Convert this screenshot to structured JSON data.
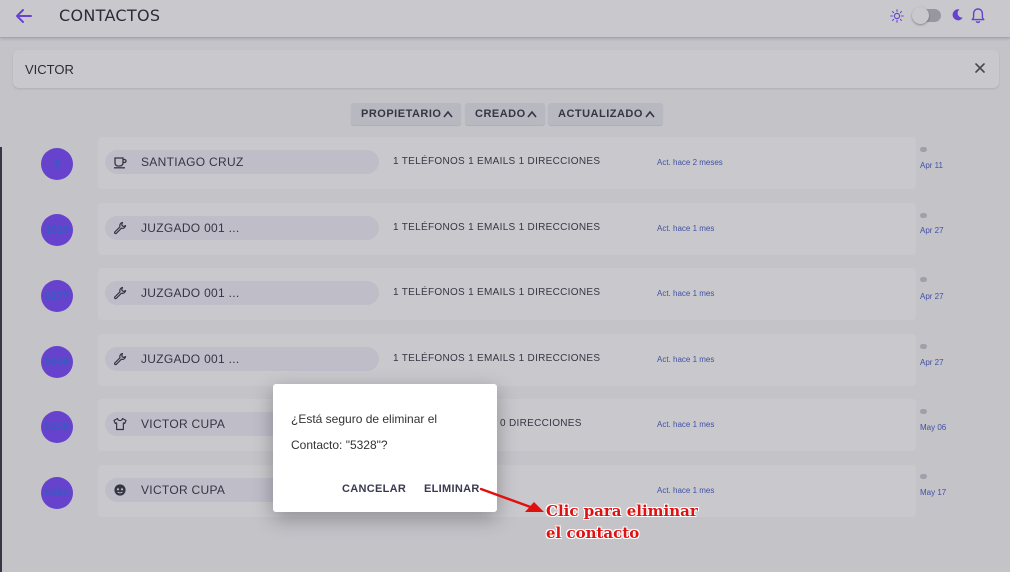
{
  "header": {
    "title": "CONTACTOS",
    "icons": {
      "back": "arrow-left-icon",
      "theme_light": "sun-icon",
      "theme_dark": "moon-icon",
      "notifications": "bell-icon"
    }
  },
  "search": {
    "value": "VICTOR",
    "clear_icon": "close-icon"
  },
  "sort": [
    {
      "label": "PROPIETARIO",
      "icon": "chevron-up-icon"
    },
    {
      "label": "CREADO",
      "icon": "chevron-up-icon"
    },
    {
      "label": "ACTUALIZADO",
      "icon": "chevron-up-icon"
    }
  ],
  "contacts": [
    {
      "id": "3",
      "name": "SANTIAGO CRUZ",
      "icon": "cup-icon",
      "summary": "1 TELÉFONOS 1 EMAILS 1 DIRECCIONES",
      "updated": "Act. hace 2 meses",
      "date": "Apr 11"
    },
    {
      "id": "1919",
      "name": "JUZGADO 001 ...",
      "icon": "wrench-icon",
      "summary": "1 TELÉFONOS 1 EMAILS 1 DIRECCIONES",
      "updated": "Act. hace 1 mes",
      "date": "Apr 27"
    },
    {
      "id": "2177",
      "name": "JUZGADO 001 ...",
      "icon": "wrench-icon",
      "summary": "1 TELÉFONOS 1 EMAILS 1 DIRECCIONES",
      "updated": "Act. hace 1 mes",
      "date": "Apr 27"
    },
    {
      "id": "5046",
      "name": "JUZGADO 001 ...",
      "icon": "wrench-icon",
      "summary": "1 TELÉFONOS 1 EMAILS 1 DIRECCIONES",
      "updated": "Act. hace 1 mes",
      "date": "Apr 27"
    },
    {
      "id": "5328",
      "name": "VICTOR CUPA",
      "icon": "shirt-icon",
      "summary": "S 0 DIRECCIONES",
      "updated": "Act. hace 1 mes",
      "date": "May 06"
    },
    {
      "id": "5354",
      "name": "VICTOR CUPA",
      "icon": "face-icon",
      "summary": "",
      "updated": "Act. hace 1 mes",
      "date": "May 17"
    }
  ],
  "dialog": {
    "message": "¿Está seguro de eliminar el Contacto: \"5328\"?",
    "cancel_label": "CANCELAR",
    "confirm_label": "ELIMINAR"
  },
  "annotation": {
    "line1": "Clic para eliminar",
    "line2": "el contacto"
  },
  "colors": {
    "accent": "#7c4dff",
    "link": "#4b5ec7",
    "annotation": "#e01010"
  }
}
